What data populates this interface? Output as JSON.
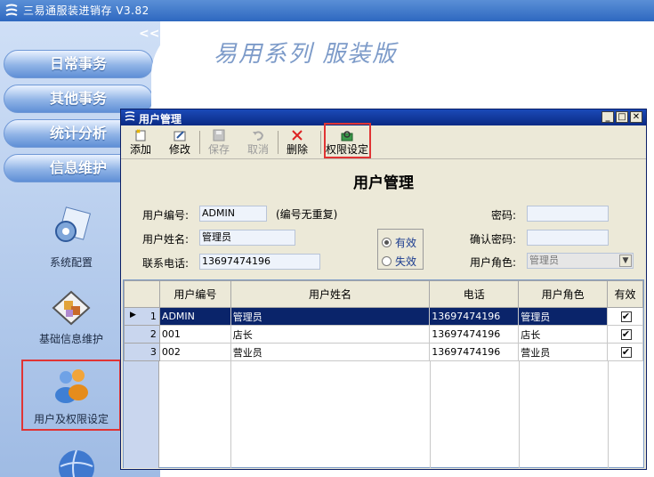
{
  "window": {
    "title": "三易通服装进销存 V3.82"
  },
  "brand": {
    "slogan": "易用系列 服装版"
  },
  "sidebar": {
    "collapse": "<<",
    "nav": [
      {
        "label": "日常事务"
      },
      {
        "label": "其他事务"
      },
      {
        "label": "统计分析"
      },
      {
        "label": "信息维护"
      }
    ],
    "modules": [
      {
        "label": "系统配置",
        "icon": "system-config-icon"
      },
      {
        "label": "基础信息维护",
        "icon": "basic-info-icon"
      },
      {
        "label": "用户及权限设定",
        "icon": "users-icon"
      }
    ]
  },
  "dialog": {
    "title": "用户管理",
    "toolbar": [
      {
        "label": "添加",
        "icon": "add-icon",
        "enabled": true
      },
      {
        "label": "修改",
        "icon": "edit-icon",
        "enabled": true
      },
      {
        "label": "保存",
        "icon": "save-icon",
        "enabled": false
      },
      {
        "label": "取消",
        "icon": "undo-icon",
        "enabled": false
      },
      {
        "label": "删除",
        "icon": "delete-icon",
        "enabled": true
      },
      {
        "label": "权限设定",
        "icon": "permission-icon",
        "enabled": true
      }
    ],
    "form": {
      "heading": "用户管理",
      "user_id_label": "用户编号:",
      "user_id_value": "ADMIN",
      "user_id_hint": "(编号无重复)",
      "user_name_label": "用户姓名:",
      "user_name_value": "管理员",
      "phone_label": "联系电话:",
      "phone_value": "13697474196",
      "password_label": "密码:",
      "password_value": "",
      "confirm_label": "确认密码:",
      "confirm_value": "",
      "role_label": "用户角色:",
      "role_value": "管理员",
      "radio_valid": "有效",
      "radio_invalid": "失效"
    },
    "grid": {
      "columns": [
        "用户编号",
        "用户姓名",
        "电话",
        "用户角色",
        "有效"
      ],
      "rows": [
        {
          "no": "1",
          "id": "ADMIN",
          "name": "管理员",
          "phone": "13697474196",
          "role": "管理员",
          "valid": "✔"
        },
        {
          "no": "2",
          "id": "001",
          "name": "店长",
          "phone": "13697474196",
          "role": "店长",
          "valid": "✔"
        },
        {
          "no": "3",
          "id": "002",
          "name": "营业员",
          "phone": "13697474196",
          "role": "营业员",
          "valid": "✔"
        }
      ]
    }
  },
  "colors": {
    "highlight": "#e03434",
    "selected_row": "#0a246a",
    "sidebar": "#9fbbe4"
  }
}
